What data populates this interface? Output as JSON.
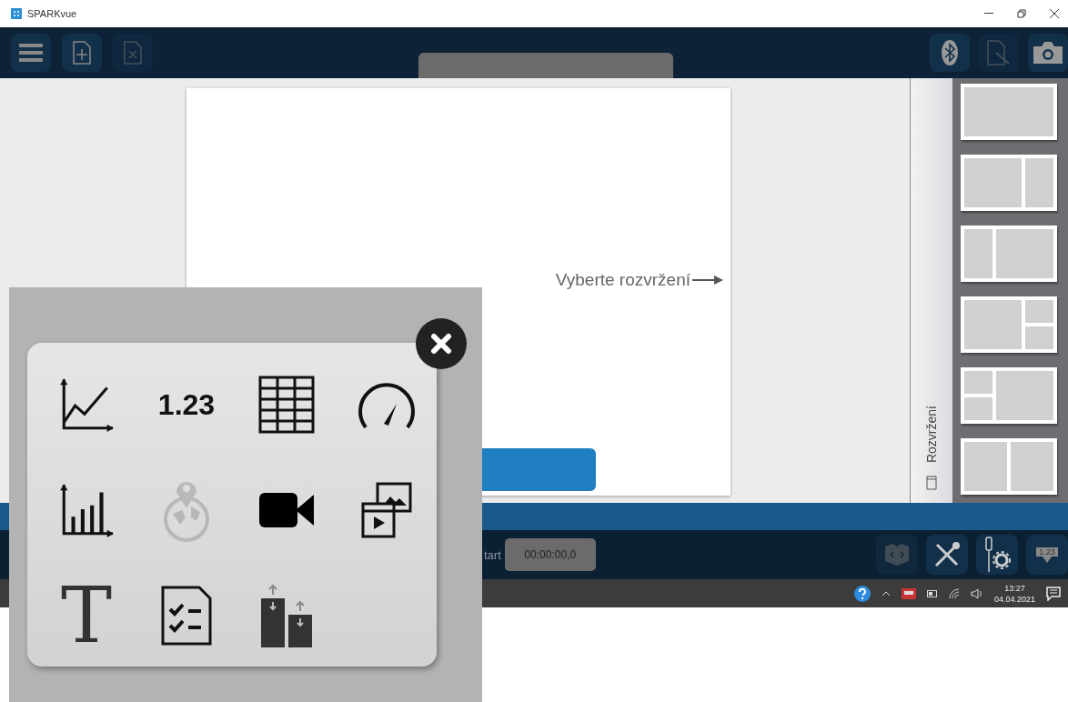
{
  "window": {
    "title": "SPARKvue"
  },
  "page": {
    "hint": "Vyberte rozvržení"
  },
  "layout_panel": {
    "tab_label": "Rozvržení",
    "thumbnails": [
      {
        "kind": "full"
      },
      {
        "kind": "leftwide"
      },
      {
        "kind": "rightwide"
      },
      {
        "kind": "rightsplit"
      },
      {
        "kind": "leftsplit"
      },
      {
        "kind": "halves"
      }
    ]
  },
  "controls": {
    "start_label": "tart",
    "timer": "00:00:00,0",
    "meter_label": "1.23"
  },
  "taskbar": {
    "time": "13:27",
    "date": "04.04.2021"
  },
  "popup": {
    "tools": [
      {
        "kind": "graph",
        "disabled": false
      },
      {
        "kind": "digits",
        "label": "1.23",
        "disabled": false
      },
      {
        "kind": "table",
        "disabled": false
      },
      {
        "kind": "meter",
        "disabled": false
      },
      {
        "kind": "bar-graph",
        "disabled": false
      },
      {
        "kind": "map",
        "disabled": true
      },
      {
        "kind": "video",
        "disabled": false
      },
      {
        "kind": "media",
        "disabled": false
      },
      {
        "kind": "text",
        "label": "T",
        "disabled": false
      },
      {
        "kind": "quiz",
        "disabled": false
      },
      {
        "kind": "compare",
        "disabled": false
      }
    ]
  }
}
